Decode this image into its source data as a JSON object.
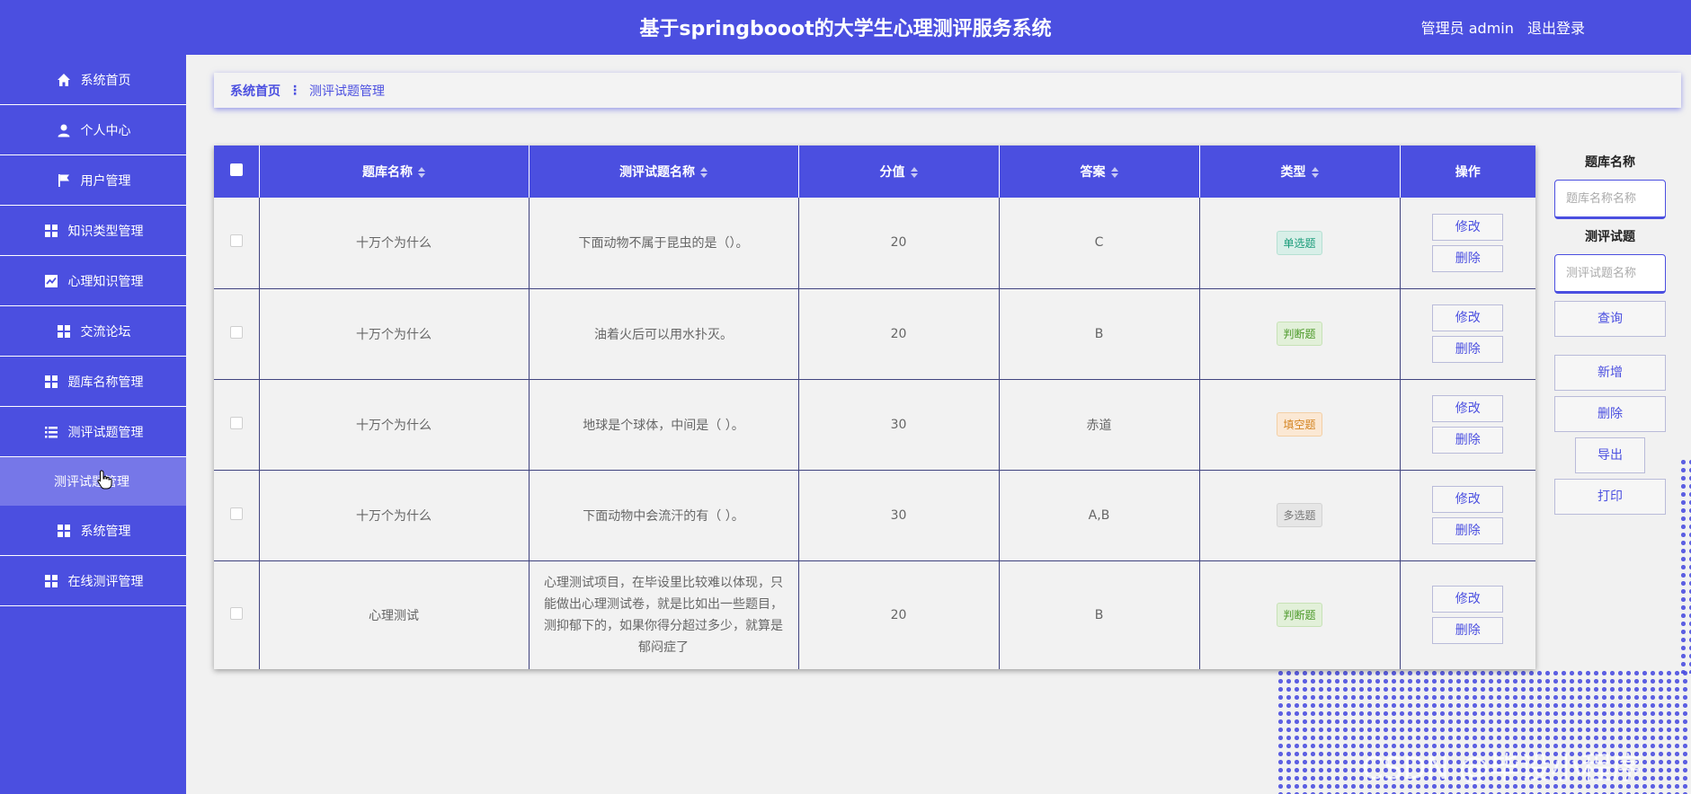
{
  "header": {
    "title": "基于springbooot的大学生心理测评服务系统",
    "user_label": "管理员 admin",
    "logout_label": "退出登录"
  },
  "sidebar": {
    "items": [
      {
        "label": "系统首页",
        "icon": "home-icon"
      },
      {
        "label": "个人中心",
        "icon": "person-icon"
      },
      {
        "label": "用户管理",
        "icon": "flag-icon"
      },
      {
        "label": "知识类型管理",
        "icon": "grid-icon"
      },
      {
        "label": "心理知识管理",
        "icon": "chart-icon"
      },
      {
        "label": "交流论坛",
        "icon": "grid-icon"
      },
      {
        "label": "题库名称管理",
        "icon": "grid-icon"
      },
      {
        "label": "测评试题管理",
        "icon": "list-icon"
      }
    ],
    "sub_item": "测评试题管理",
    "items_after": [
      {
        "label": "系统管理",
        "icon": "grid-icon"
      },
      {
        "label": "在线测评管理",
        "icon": "grid-icon"
      }
    ]
  },
  "breadcrumb": {
    "home": "系统首页",
    "current": "测评试题管理"
  },
  "table": {
    "columns": [
      "题库名称",
      "测评试题名称",
      "分值",
      "答案",
      "类型",
      "操作"
    ],
    "rows": [
      {
        "bank": "十万个为什么",
        "question": "下面动物不属于昆虫的是（）。",
        "score": "20",
        "answer": "C",
        "type": "单选题"
      },
      {
        "bank": "十万个为什么",
        "question": "油着火后可以用水扑灭。",
        "score": "20",
        "answer": "B",
        "type": "判断题"
      },
      {
        "bank": "十万个为什么",
        "question": "地球是个球体，中间是（ ）。",
        "score": "30",
        "answer": "赤道",
        "type": "填空题"
      },
      {
        "bank": "十万个为什么",
        "question": "下面动物中会流汗的有（ ）。",
        "score": "30",
        "answer": "A,B",
        "type": "多选题"
      },
      {
        "bank": "心理测试",
        "question": "心理测试项目，在毕设里比较难以体现，只能做出心理测试卷，就是比如出一些题目，测抑郁下的，如果你得分超过多少，就算是郁闷症了",
        "score": "20",
        "answer": "B",
        "type": "判断题"
      }
    ],
    "edit_label": "修改",
    "delete_label": "删除"
  },
  "search": {
    "bank_label": "题库名称",
    "bank_placeholder": "题库名称名称",
    "question_label": "测评试题",
    "question_placeholder": "测评试题名称",
    "query_label": "查询",
    "add_label": "新增",
    "delete_label": "删除",
    "export_label": "导出",
    "print_label": "打印"
  },
  "watermark": "CSDN @毕设小程序",
  "colors": {
    "primary": "#4b4fe0",
    "background": "#f1f1f1",
    "submenu": "#7677e8"
  }
}
